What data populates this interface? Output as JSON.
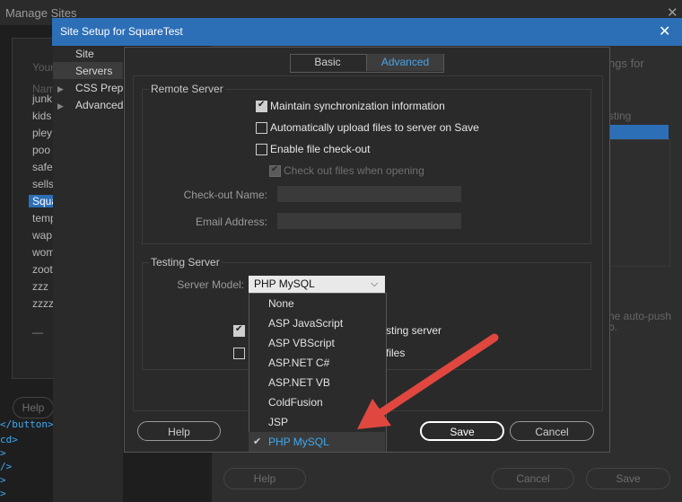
{
  "bg": {
    "title": "Manage Sites",
    "your_label": "Your",
    "name_label": "Nam",
    "sites": [
      "junk",
      "kids",
      "pley",
      "poo",
      "safe",
      "sells",
      "Squa",
      "temp",
      "wap",
      "wom",
      "zoot",
      "zzz",
      "zzzz"
    ],
    "minus": "—",
    "help_btn": "Help",
    "code_lines": [
      "</button>",
      "cd>",
      ">",
      "/>",
      ">",
      ">"
    ],
    "right_text_1": "ngs for",
    "right_text_2": "he auto-push",
    "right_text_3": "b.",
    "right_tab": "sting",
    "help2": "Help",
    "cancel2": "Cancel",
    "save2": "Save"
  },
  "dialog": {
    "title": "Site Setup for SquareTest",
    "sidebar": [
      "Site",
      "Servers",
      "CSS Prepro",
      "Advanced"
    ]
  },
  "advanced": {
    "tabs": {
      "basic": "Basic",
      "advanced": "Advanced"
    },
    "remote_server": {
      "heading": "Remote Server",
      "maintain_sync": "Maintain synchronization information",
      "auto_upload": "Automatically upload files to server on Save",
      "enable_checkout": "Enable file check-out",
      "checkout_when_opening": "Check out files when opening",
      "checkout_name_label": "Check-out Name:",
      "email_label": "Email Address:",
      "checkout_name_value": "",
      "email_value": ""
    },
    "testing_server": {
      "heading": "Testing Server",
      "server_model_label": "Server Model:",
      "server_model_value": "PHP MySQL",
      "partial_1": "sting server",
      "partial_2": "files",
      "options": [
        "None",
        "ASP JavaScript",
        "ASP VBScript",
        "ASP.NET C#",
        "ASP.NET VB",
        "ColdFusion",
        "JSP",
        "PHP MySQL"
      ],
      "selected_index": 7
    },
    "buttons": {
      "help": "Help",
      "save": "Save",
      "cancel": "Cancel"
    }
  },
  "colors": {
    "accent": "#2d6fb7",
    "arrow": "#e0473f",
    "link": "#3fa9f5"
  }
}
